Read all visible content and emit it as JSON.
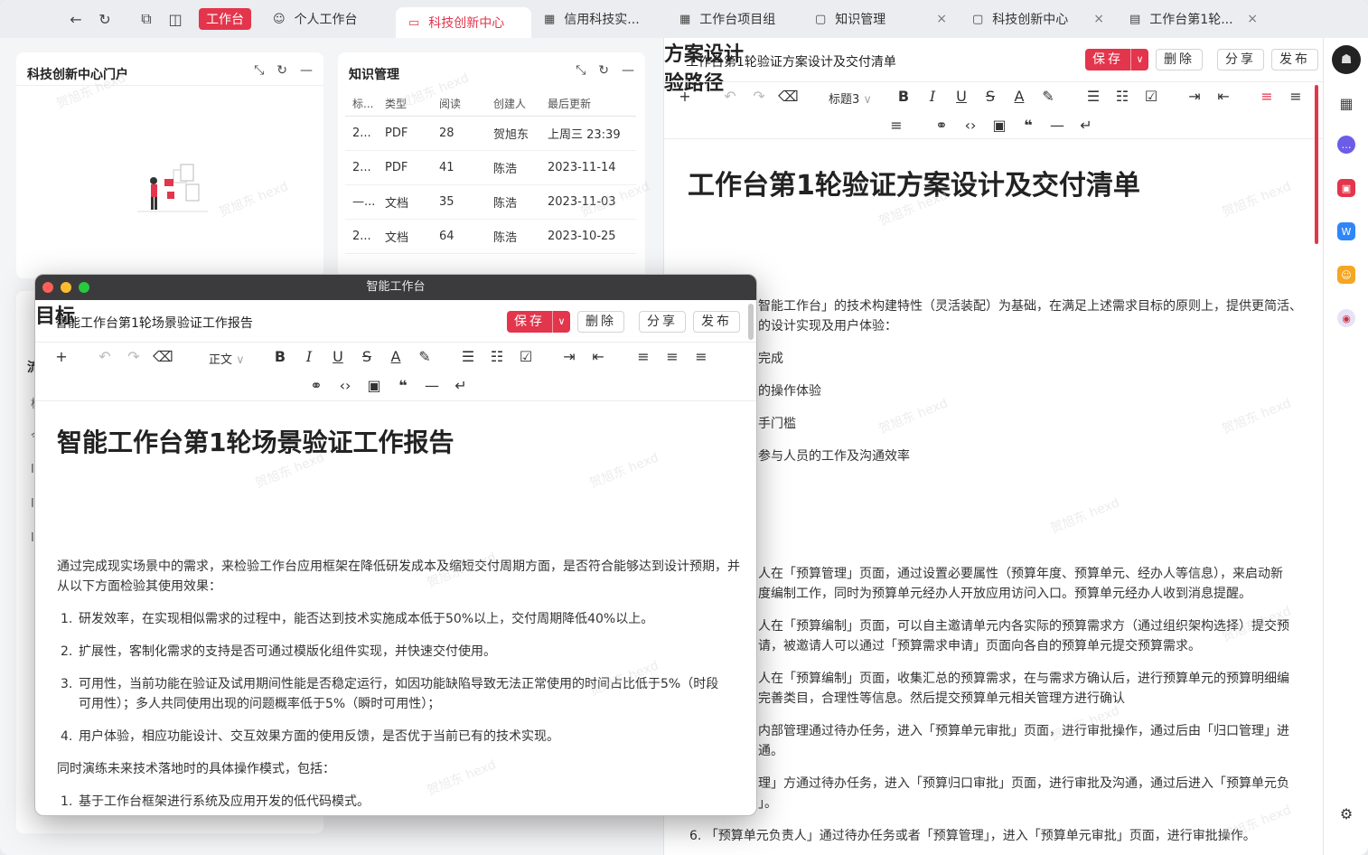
{
  "tabbar": {
    "workbench": "工作台",
    "tabs": [
      {
        "label": "个人工作台",
        "icon": "user-icon"
      },
      {
        "label": "科技创新中心",
        "icon": "monitor-icon"
      },
      {
        "label": "信用科技实...",
        "icon": "board-icon"
      },
      {
        "label": "工作台项目组",
        "icon": "board-icon"
      },
      {
        "label": "知识管理",
        "icon": "folder-icon"
      },
      {
        "label": "科技创新中心",
        "icon": "folder-icon"
      },
      {
        "label": "工作台第1轮...",
        "icon": "file-icon"
      }
    ]
  },
  "portal": {
    "title": "科技创新中心门户"
  },
  "knowledge": {
    "title": "知识管理",
    "headers": [
      "标...",
      "类型",
      "阅读",
      "创建人",
      "最后更新"
    ],
    "rows": [
      [
        "2...",
        "PDF",
        "28",
        "贺旭东",
        "上周三 23:39"
      ],
      [
        "2...",
        "PDF",
        "41",
        "陈浩",
        "2023-11-14"
      ],
      [
        "—...",
        "文档",
        "35",
        "陈浩",
        "2023-11-03"
      ],
      [
        "2...",
        "文档",
        "64",
        "陈浩",
        "2023-10-25"
      ]
    ]
  },
  "doc": {
    "bar_title": "工作台第1轮验证方案设计及交付清单",
    "save": "保存",
    "delete": "删除",
    "share": "分享",
    "publish": "发布",
    "heading_select": "标题3",
    "h1": "工作台第1轮验证方案设计及交付清单",
    "h2a": "方案设计",
    "para": [
      "智能工作台」的技术构建特性（灵活装配）为基础，在满足上述需求目标的原则上，提供更简活、",
      "的设计实现及用户体验："
    ],
    "short_items": [
      "完成",
      "的操作体验",
      "手门槛",
      "参与人员的工作及沟通效率"
    ],
    "h2b": "验路径",
    "path_items": [
      [
        "人在「预算管理」页面，通过设置必要属性（预算年度、预算单元、经办人等信息），来启动新",
        "度编制工作，同时为预算单元经办人开放应用访问入口。预算单元经办人收到消息提醒。"
      ],
      [
        "人在「预算编制」页面，可以自主邀请单元内各实际的预算需求方（通过组织架构选择）提交预",
        "请，被邀请人可以通过「预算需求申请」页面向各自的预算单元提交预算需求。"
      ],
      [
        "人在「预算编制」页面，收集汇总的预算需求，在与需求方确认后，进行预算单元的预算明细编",
        "完善类目，合理性等信息。然后提交预算单元相关管理方进行确认"
      ],
      [
        "内部管理通过待办任务，进入「预算单元审批」页面，进行审批操作，通过后由「归口管理」进",
        "通。"
      ],
      [
        "理」方通过待办任务，进入「预算归口审批」页面，进行审批及沟通，通过后进入「预算单元负",
        "」。"
      ]
    ],
    "item6": "6.  「预算单元负责人」通过待办任务或者「预算管理」，进入「预算单元审批」页面，进行审批操作。"
  },
  "win": {
    "title": "智能工作台",
    "bar_title": "智能工作台第1轮场景验证工作报告",
    "save": "保存",
    "delete": "删除",
    "share": "分享",
    "publish": "发布",
    "para_select": "正文",
    "h1": "智能工作台第1轮场景验证工作报告",
    "h2": "目标",
    "intro": [
      "通过完成现实场景中的需求，来检验工作台应用框架在降低研发成本及缩短交付周期方面，是否符合能够达到设计预期，并",
      "从以下方面检验其使用效果："
    ],
    "items": [
      [
        "1.",
        "研发效率，在实现相似需求的过程中，能否达到技术实施成本低于50%以上，交付周期降低40%以上。"
      ],
      [
        "2.",
        "扩展性，客制化需求的支持是否可通过模版化组件实现，并快速交付使用。"
      ],
      [
        "3.",
        "可用性，当前功能在验证及试用期间性能是否稳定运行，如因功能缺陷导致无法正常使用的时间占比低于5%（时段"
      ],
      [
        "",
        "可用性）；多人共同使用出现的问题概率低于5%（瞬时可用性）；"
      ],
      [
        "4.",
        "用户体验，相应功能设计、交互效果方面的使用反馈，是否优于当前已有的技术实现。"
      ]
    ],
    "para2": "同时演练未来技术落地时的具体操作模式，包括：",
    "item_b1": "1.",
    "item_b1_text": "基于工作台框架进行系统及应用开发的低代码模式。"
  },
  "left_cut": [
    "流",
    "栖",
    "今",
    "I",
    "I",
    "I"
  ],
  "watermark": "贺旭东 hexd",
  "colors": {
    "accent": "#e3354b"
  }
}
